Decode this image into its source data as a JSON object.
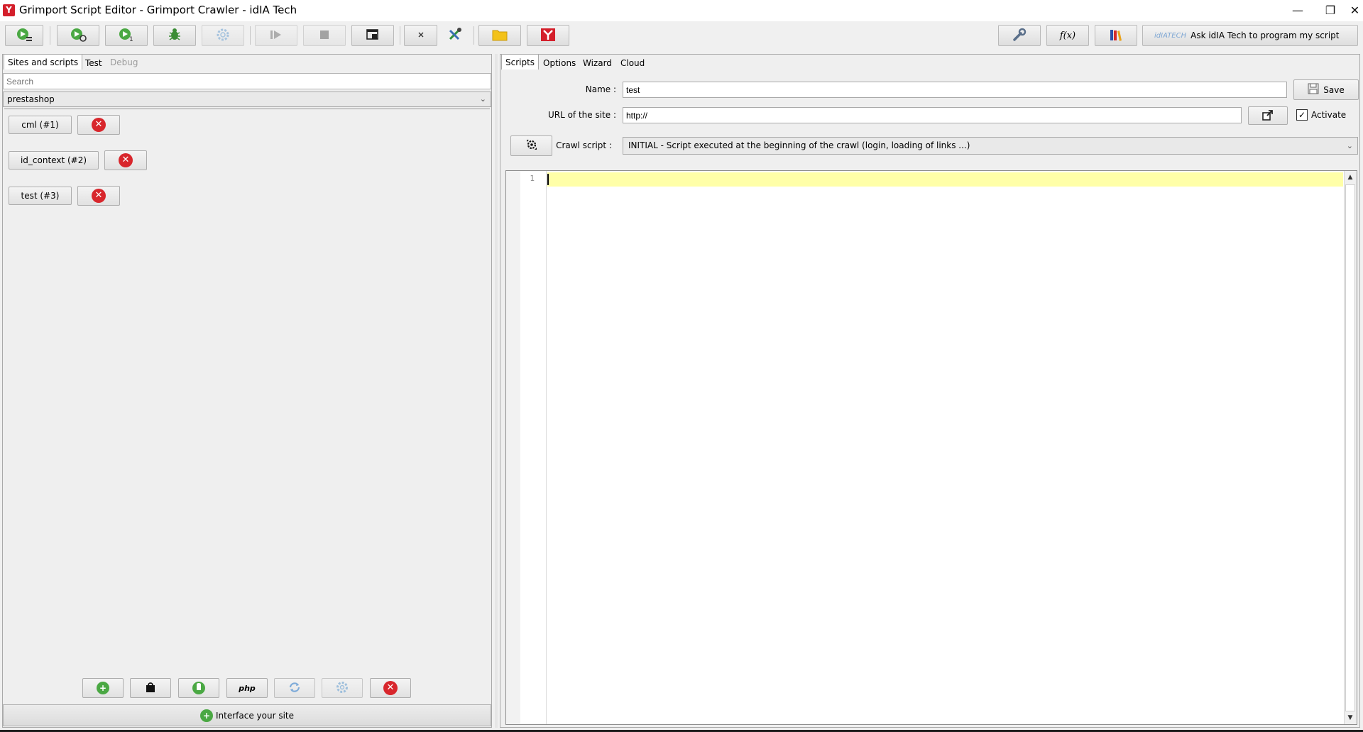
{
  "window": {
    "title": "Grimport Script Editor - Grimport Crawler - idIA Tech",
    "logo_letter": "Y",
    "minimize_glyph": "—",
    "maximize_glyph": "❐",
    "close_glyph": "✕"
  },
  "toolbar": {
    "left_icons": [
      "run-crawler-icon",
      "run-refresh-icon",
      "run-update-icon",
      "debug-bug-icon",
      "settings-gear-icon",
      "play-icon",
      "stop-icon",
      "window-icon",
      "pin-icon",
      "tools-icon",
      "folder-icon",
      "grimport-logo-icon"
    ],
    "right_icons": [
      "wrench-icon",
      "function-icon",
      "books-icon"
    ],
    "function_glyph": "f(x)",
    "ask_label": "Ask idIA Tech to program my script",
    "ask_logo": "idIATECH"
  },
  "left_panel": {
    "tabs": [
      {
        "label": "Sites and scripts",
        "state": "active"
      },
      {
        "label": "Test",
        "state": "normal"
      },
      {
        "label": "Debug",
        "state": "disabled"
      }
    ],
    "search_placeholder": "Search",
    "site_selected": "prestashop",
    "scripts": [
      {
        "label": "cml (#1)"
      },
      {
        "label": "id_context (#2)"
      },
      {
        "label": "test (#3)"
      }
    ],
    "bottom_buttons": [
      "add-icon",
      "shopping-bag-icon",
      "shirt-icon",
      "php-icon",
      "refresh-icon",
      "settings-icon",
      "delete-icon"
    ],
    "php_glyph": "php",
    "interface_label": "Interface your site"
  },
  "right_panel": {
    "tabs": [
      {
        "label": "Scripts",
        "state": "active"
      },
      {
        "label": "Options",
        "state": "normal"
      },
      {
        "label": "Wizard",
        "state": "normal"
      },
      {
        "label": "Cloud",
        "state": "normal"
      }
    ],
    "name_label": "Name :",
    "name_value": "test",
    "save_label": "Save",
    "url_label": "URL of the site :",
    "url_value": "http://",
    "activate_label": "Activate",
    "activate_checked": true,
    "crawl_label": "Crawl script :",
    "crawl_value": "INITIAL - Script executed at the beginning of the crawl (login, loading of links ...)",
    "editor": {
      "line_numbers": [
        "1"
      ],
      "content": "",
      "current_line_color": "#ffffa8"
    }
  },
  "colors": {
    "accent_green": "#4aa843",
    "danger_red": "#d8262c",
    "brand_red": "#d41f2b",
    "folder_yellow": "#f3c21a"
  }
}
